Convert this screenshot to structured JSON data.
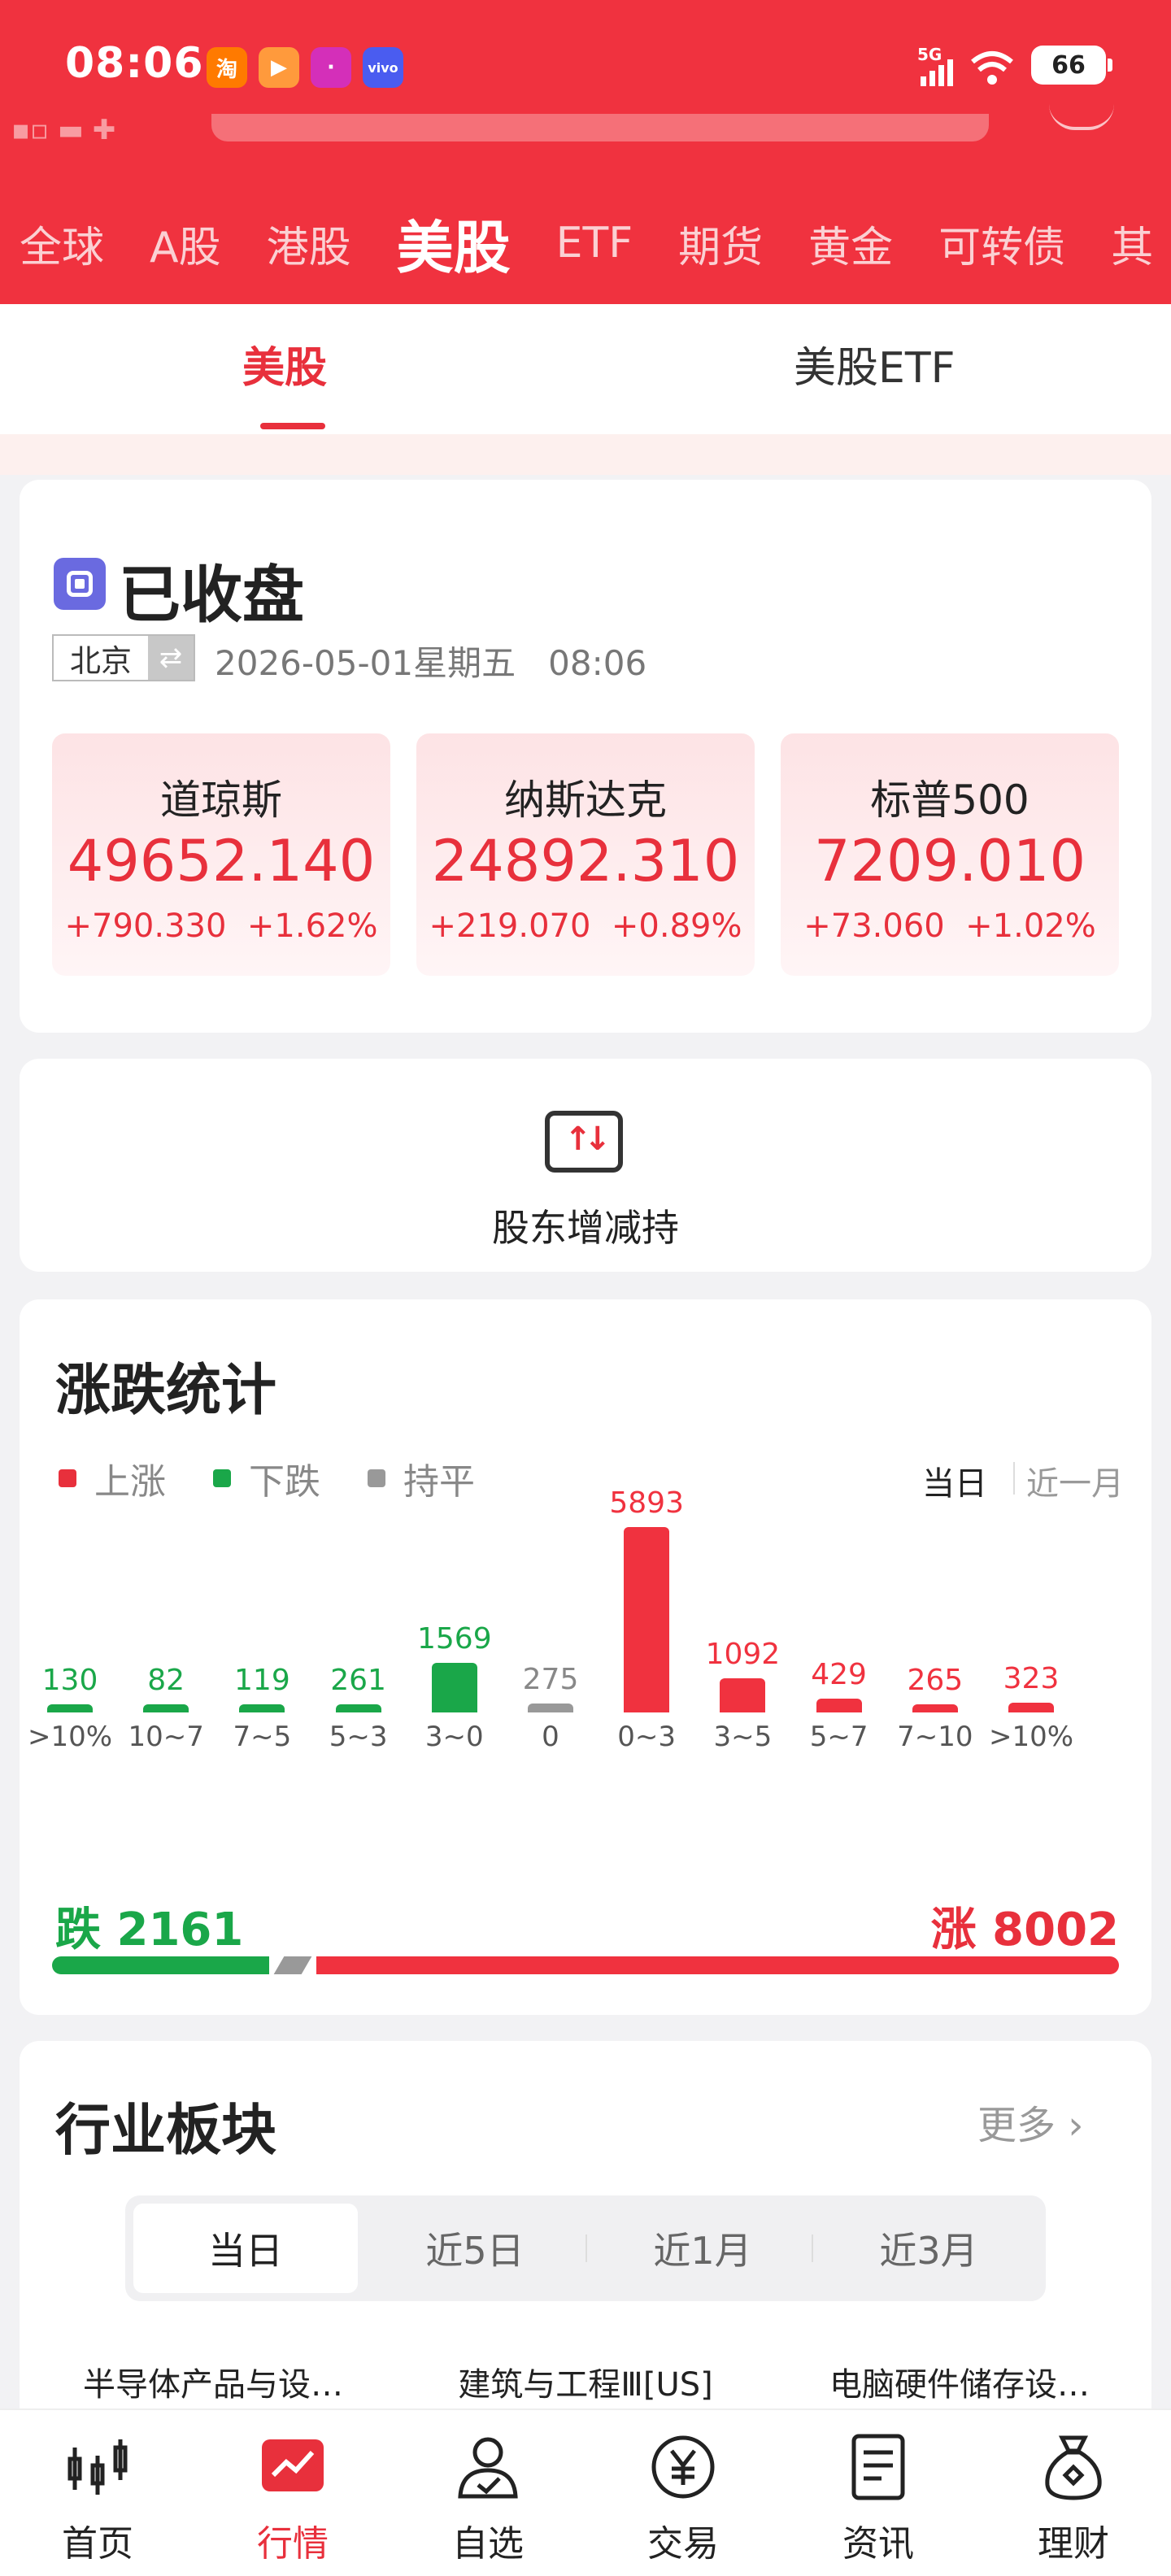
{
  "status_bar": {
    "time": "08:06",
    "apps": [
      {
        "label": "淘",
        "color": "#ff7a00"
      },
      {
        "label": "▶",
        "color": "#ff9a3c"
      },
      {
        "label": "·",
        "color": "#d42fb9"
      },
      {
        "label": "vivo",
        "color": "#4a5cf0"
      }
    ],
    "network": "5G",
    "battery": "66"
  },
  "market_tabs": [
    "全球",
    "A股",
    "港股",
    "美股",
    "ETF",
    "期货",
    "黄金",
    "可转债",
    "其"
  ],
  "active_market": "美股",
  "sub_tabs": [
    "美股",
    "美股ETF"
  ],
  "market_status": {
    "title": "已收盘",
    "location": "北京",
    "date": "2026-05-01",
    "weekday": "星期五",
    "time": "08:06"
  },
  "indices": [
    {
      "name": "道琼斯",
      "value": "49652.140",
      "change": "+790.330",
      "pct": "+1.62%"
    },
    {
      "name": "纳斯达克",
      "value": "24892.310",
      "change": "+219.070",
      "pct": "+0.89%"
    },
    {
      "name": "标普500",
      "value": "7209.010",
      "change": "+73.060",
      "pct": "+1.02%"
    }
  ],
  "holder": {
    "label": "股东增减持"
  },
  "stats": {
    "title": "涨跌统计",
    "legend": [
      "上涨",
      "下跌",
      "持平"
    ],
    "range_tabs": [
      "当日",
      "近一月"
    ],
    "fall_label": "跌",
    "fall_total": "2161",
    "rise_label": "涨",
    "rise_total": "8002"
  },
  "chart_data": {
    "type": "bar",
    "categories": [
      ">10%",
      "10~7",
      "7~5",
      "5~3",
      "3~0",
      "0",
      "0~3",
      "3~5",
      "5~7",
      "7~10",
      ">10%"
    ],
    "values": [
      130,
      82,
      119,
      261,
      1569,
      275,
      5893,
      1092,
      429,
      265,
      323
    ],
    "bar_colors": [
      "#1aa749",
      "#1aa749",
      "#1aa749",
      "#1aa749",
      "#1aa749",
      "#999999",
      "#f0323f",
      "#f0323f",
      "#f0323f",
      "#f0323f",
      "#f0323f"
    ],
    "totals": {
      "fall": 2161,
      "flat": 275,
      "rise": 8002
    }
  },
  "sector": {
    "title": "行业板块",
    "more": "更多",
    "periods": [
      "当日",
      "近5日",
      "近1月",
      "近3月"
    ],
    "names": [
      "半导体产品与设…",
      "建筑与工程Ⅲ[US]",
      "电脑硬件储存设…"
    ]
  },
  "bottom_nav": [
    "首页",
    "行情",
    "自选",
    "交易",
    "资讯",
    "理财"
  ],
  "colors": {
    "brand": "#f0323f",
    "rise": "#e8303c",
    "fall": "#1aa749",
    "flat": "#999999"
  }
}
